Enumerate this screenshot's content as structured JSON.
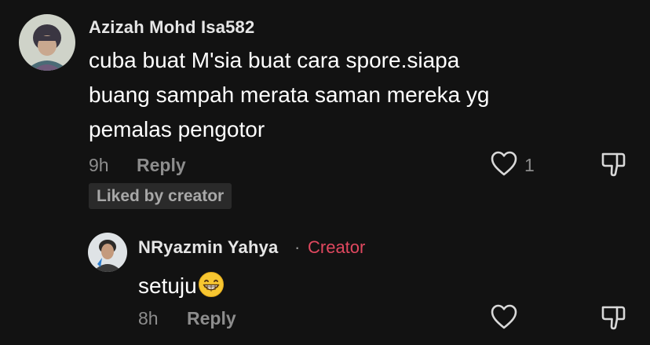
{
  "comments": [
    {
      "username": "Azizah Mohd Isa582",
      "text_lines": [
        "cuba buat M'sia buat cara spore.siapa",
        "buang sampah merata saman mereka yg",
        "pemalas pengotor"
      ],
      "time": "9h",
      "reply_label": "Reply",
      "like_count": "1",
      "liked_badge": "Liked by creator",
      "avatar_icon": "user-avatar-photo",
      "heart_icon": "heart-outline-icon",
      "dislike_icon": "thumbs-down-icon"
    }
  ],
  "reply": {
    "username": "NRyazmin Yahya",
    "separator": "·",
    "creator_label": "Creator",
    "text": "setuju",
    "emoji": "grinning-face-emoji",
    "time": "8h",
    "reply_label": "Reply",
    "avatar_icon": "user-avatar-photo",
    "heart_icon": "heart-outline-icon",
    "dislike_icon": "thumbs-down-icon"
  },
  "colors": {
    "background": "#121212",
    "text_primary": "#ffffff",
    "text_secondary": "#8d8d8d",
    "creator_accent": "#e0485f",
    "badge_bg": "#2a2a2a"
  }
}
